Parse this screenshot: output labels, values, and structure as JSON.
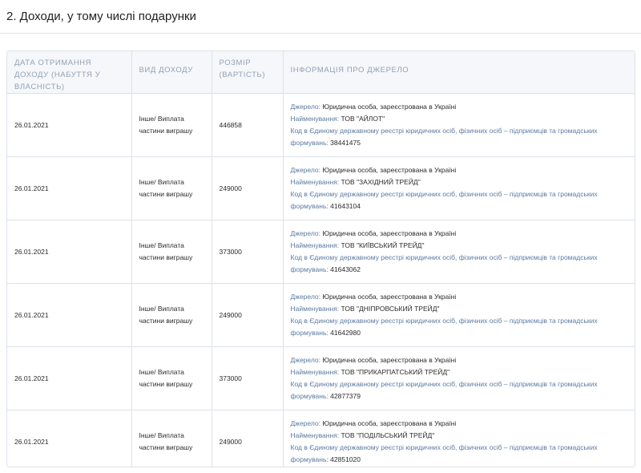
{
  "section": {
    "title": "2. Доходи, у тому числі подарунки"
  },
  "table": {
    "headers": {
      "date": "ДАТА ОТРИМАННЯ ДОХОДУ (НАБУТТЯ У ВЛАСНІСТЬ)",
      "type": "ВИД ДОХОДУ",
      "amount": "РОЗМІР (ВАРТІСТЬ)",
      "info": "ІНФОРМАЦІЯ ПРО ДЖЕРЕЛО"
    },
    "labels": {
      "source": "Джерело:",
      "name": "Найменування:",
      "code": "Код в Єдиному державному реєстрі юридичних осіб, фізичних осіб – підприємців та громадських формувань:"
    },
    "rows": [
      {
        "date": "26.01.2021",
        "type": "Інше/ Виплата частини виграшу",
        "amount": "446858",
        "source": "Юридична особа, зареєстрована в Україні",
        "name": "ТОВ \"АЙЛОТ\"",
        "code": "38441475"
      },
      {
        "date": "26.01.2021",
        "type": "Інше/ Виплата частини виграшу",
        "amount": "249000",
        "source": "Юридична особа, зареєстрована в Україні",
        "name": "ТОВ \"ЗАХІДНИЙ ТРЕЙД\"",
        "code": "41643104"
      },
      {
        "date": "26.01.2021",
        "type": "Інше/ Виплата частини виграшу",
        "amount": "373000",
        "source": "Юридична особа, зареєстрована в Україні",
        "name": "ТОВ \"КИЇВСЬКИЙ ТРЕЙД\"",
        "code": "41643062"
      },
      {
        "date": "26.01.2021",
        "type": "Інше/ Виплата частини виграшу",
        "amount": "249000",
        "source": "Юридична особа, зареєстрована в Україні",
        "name": "ТОВ \"ДНІПРОВСЬКИЙ ТРЕЙД\"",
        "code": "41642980"
      },
      {
        "date": "26.01.2021",
        "type": "Інше/ Виплата частини виграшу",
        "amount": "373000",
        "source": "Юридична особа, зареєстрована в Україні",
        "name": "ТОВ \"ПРИКАРПАТСЬКИЙ ТРЕЙД\"",
        "code": "42877379"
      },
      {
        "date": "26.01.2021",
        "type": "Інше/ Виплата частини виграшу",
        "amount": "249000",
        "source": "Юридична особа, зареєстрована в Україні",
        "name": "ТОВ \"ПОДІЛЬСЬКИЙ ТРЕЙД\"",
        "code": "42851020"
      }
    ]
  }
}
